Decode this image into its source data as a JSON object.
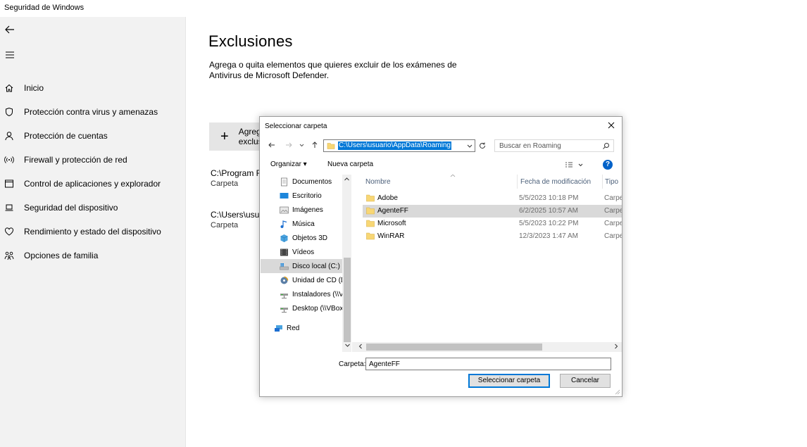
{
  "app": {
    "title": "Seguridad de Windows"
  },
  "sidebar": {
    "items": [
      {
        "label": "Inicio",
        "icon": "home-icon"
      },
      {
        "label": "Protección contra virus y amenazas",
        "icon": "shield-icon"
      },
      {
        "label": "Protección de cuentas",
        "icon": "person-icon"
      },
      {
        "label": "Firewall y protección de red",
        "icon": "wifi-icon"
      },
      {
        "label": "Control de aplicaciones y explorador",
        "icon": "browser-icon"
      },
      {
        "label": "Seguridad del dispositivo",
        "icon": "laptop-icon"
      },
      {
        "label": "Rendimiento y estado del dispositivo",
        "icon": "heart-icon"
      },
      {
        "label": "Opciones de familia",
        "icon": "family-icon"
      }
    ]
  },
  "main": {
    "title": "Exclusiones",
    "description": "Agrega o quita elementos que quieres excluir de los exámenes de Antivirus de Microsoft Defender.",
    "add_button": "Agregar una exclusión",
    "exclusions": [
      {
        "path": "C:\\Program Files",
        "type": "Carpeta"
      },
      {
        "path": "C:\\Users\\usuario",
        "type": "Carpeta"
      }
    ]
  },
  "dialog": {
    "title": "Seleccionar carpeta",
    "address": "C:\\Users\\usuario\\AppData\\Roaming",
    "search_placeholder": "Buscar en Roaming",
    "organize_label": "Organizar ▾",
    "new_folder_label": "Nueva carpeta",
    "help_label": "?",
    "tree": [
      {
        "label": "Documentos",
        "icon": "documents-icon",
        "selected": false
      },
      {
        "label": "Escritorio",
        "icon": "desktop-icon",
        "selected": false
      },
      {
        "label": "Imágenes",
        "icon": "pictures-icon",
        "selected": false
      },
      {
        "label": "Música",
        "icon": "music-icon",
        "selected": false
      },
      {
        "label": "Objetos 3D",
        "icon": "3d-objects-icon",
        "selected": false
      },
      {
        "label": "Vídeos",
        "icon": "videos-icon",
        "selected": false
      },
      {
        "label": "Disco local (C:)",
        "icon": "drive-icon",
        "selected": true
      },
      {
        "label": "Unidad de CD (D:",
        "icon": "cd-drive-icon",
        "selected": false
      },
      {
        "label": "Instaladores (\\\\V",
        "icon": "network-drive-icon",
        "selected": false
      },
      {
        "label": "Desktop (\\\\VBox",
        "icon": "network-drive-icon",
        "selected": false
      },
      {
        "label": "Red",
        "icon": "network-icon",
        "selected": false
      }
    ],
    "columns": {
      "name": "Nombre",
      "date": "Fecha de modificación",
      "type": "Tipo"
    },
    "files": [
      {
        "name": "Adobe",
        "date": "5/5/2023 10:18 PM",
        "type": "Carpe",
        "selected": false
      },
      {
        "name": "AgenteFF",
        "date": "6/2/2025 10:57 AM",
        "type": "Carpe",
        "selected": true
      },
      {
        "name": "Microsoft",
        "date": "5/5/2023 10:22 PM",
        "type": "Carpe",
        "selected": false
      },
      {
        "name": "WinRAR",
        "date": "12/3/2023 1:47 AM",
        "type": "Carpe",
        "selected": false
      }
    ],
    "folder_label": "Carpeta:",
    "folder_value": "AgenteFF",
    "select_button": "Seleccionar carpeta",
    "cancel_button": "Cancelar"
  }
}
